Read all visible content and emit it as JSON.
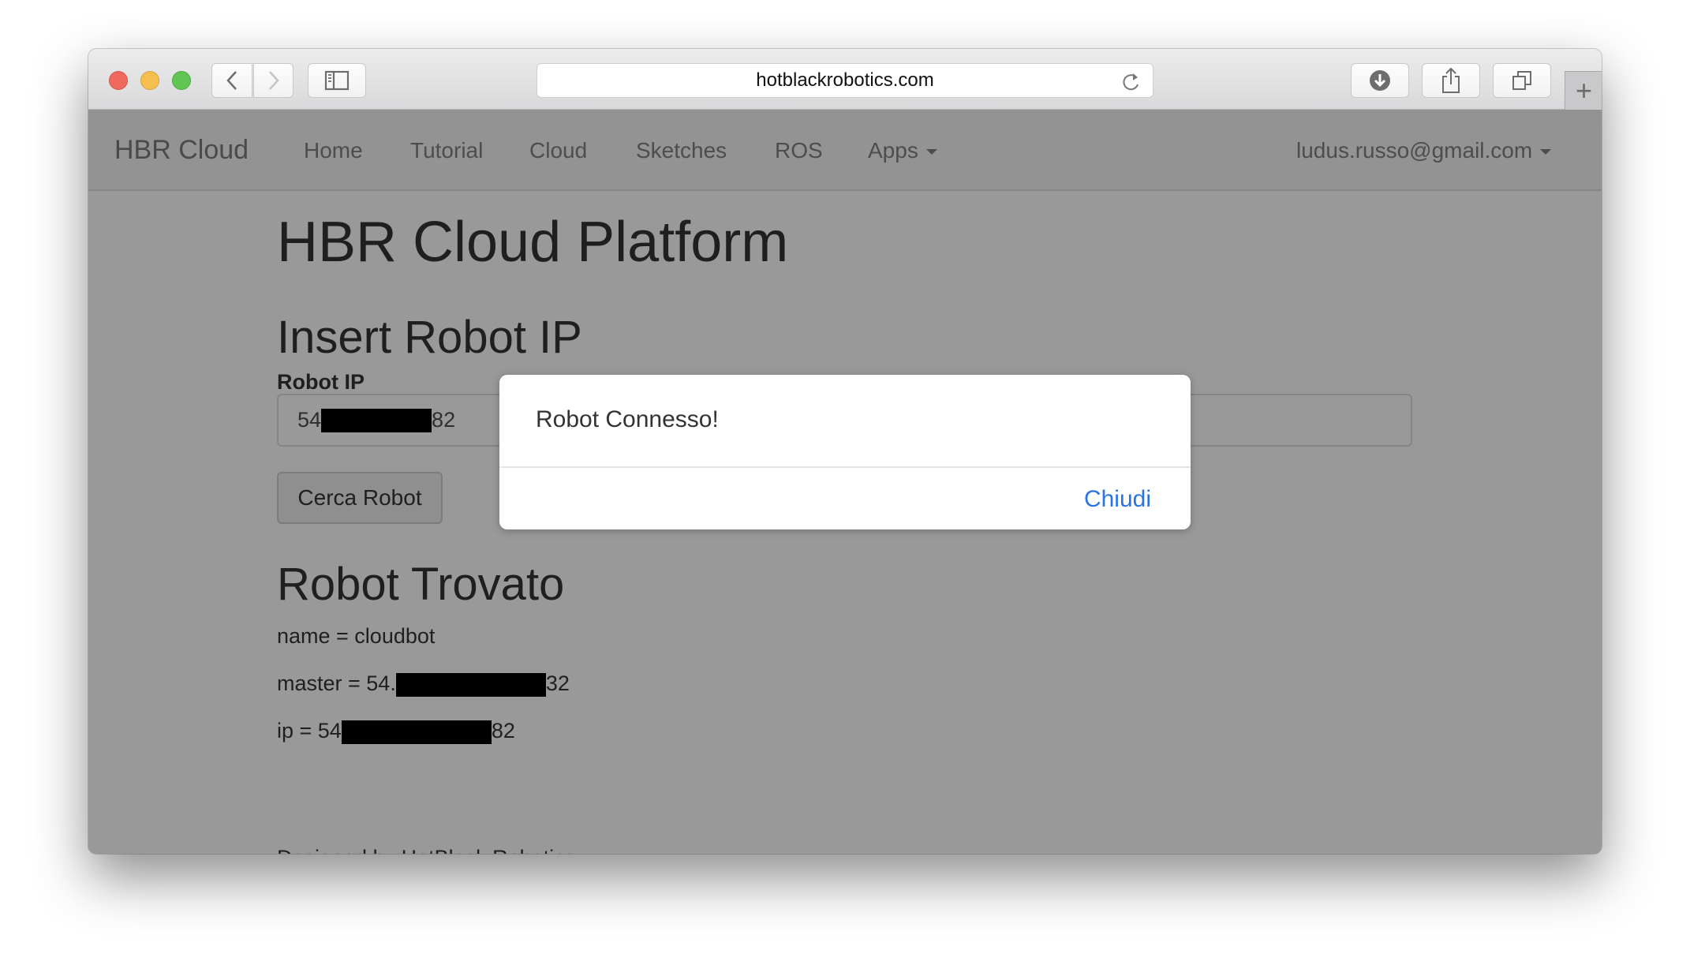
{
  "browser": {
    "url": "hotblackrobotics.com",
    "buttons": {
      "back": "chevron-left-icon",
      "forward": "chevron-right-icon",
      "sidebar": "sidebar-icon",
      "reload": "reload-icon",
      "downloads": "download-icon",
      "share": "share-icon",
      "tabs": "tabs-icon",
      "new_tab": "+"
    }
  },
  "navbar": {
    "brand": "HBR Cloud",
    "items": [
      {
        "label": "Home"
      },
      {
        "label": "Tutorial"
      },
      {
        "label": "Cloud"
      },
      {
        "label": "Sketches"
      },
      {
        "label": "ROS"
      },
      {
        "label": "Apps"
      }
    ],
    "user_email": "ludus.russo@gmail.com"
  },
  "main": {
    "title": "HBR Cloud Platform",
    "insert_heading": "Insert Robot IP",
    "ip_label": "Robot IP",
    "ip_value_prefix": "54",
    "ip_value_suffix": "82",
    "search_button": "Cerca Robot",
    "found_heading": "Robot Trovato",
    "info": {
      "name": "name = cloudbot",
      "master_prefix": "master = 54.",
      "master_suffix": "32",
      "ip_prefix": "ip = 54",
      "ip_suffix": "82"
    },
    "footer": "Designed by HotBlack Robotics"
  },
  "dialog": {
    "message": "Robot Connesso!",
    "close_button": "Chiudi",
    "accent": "#2a74df"
  }
}
